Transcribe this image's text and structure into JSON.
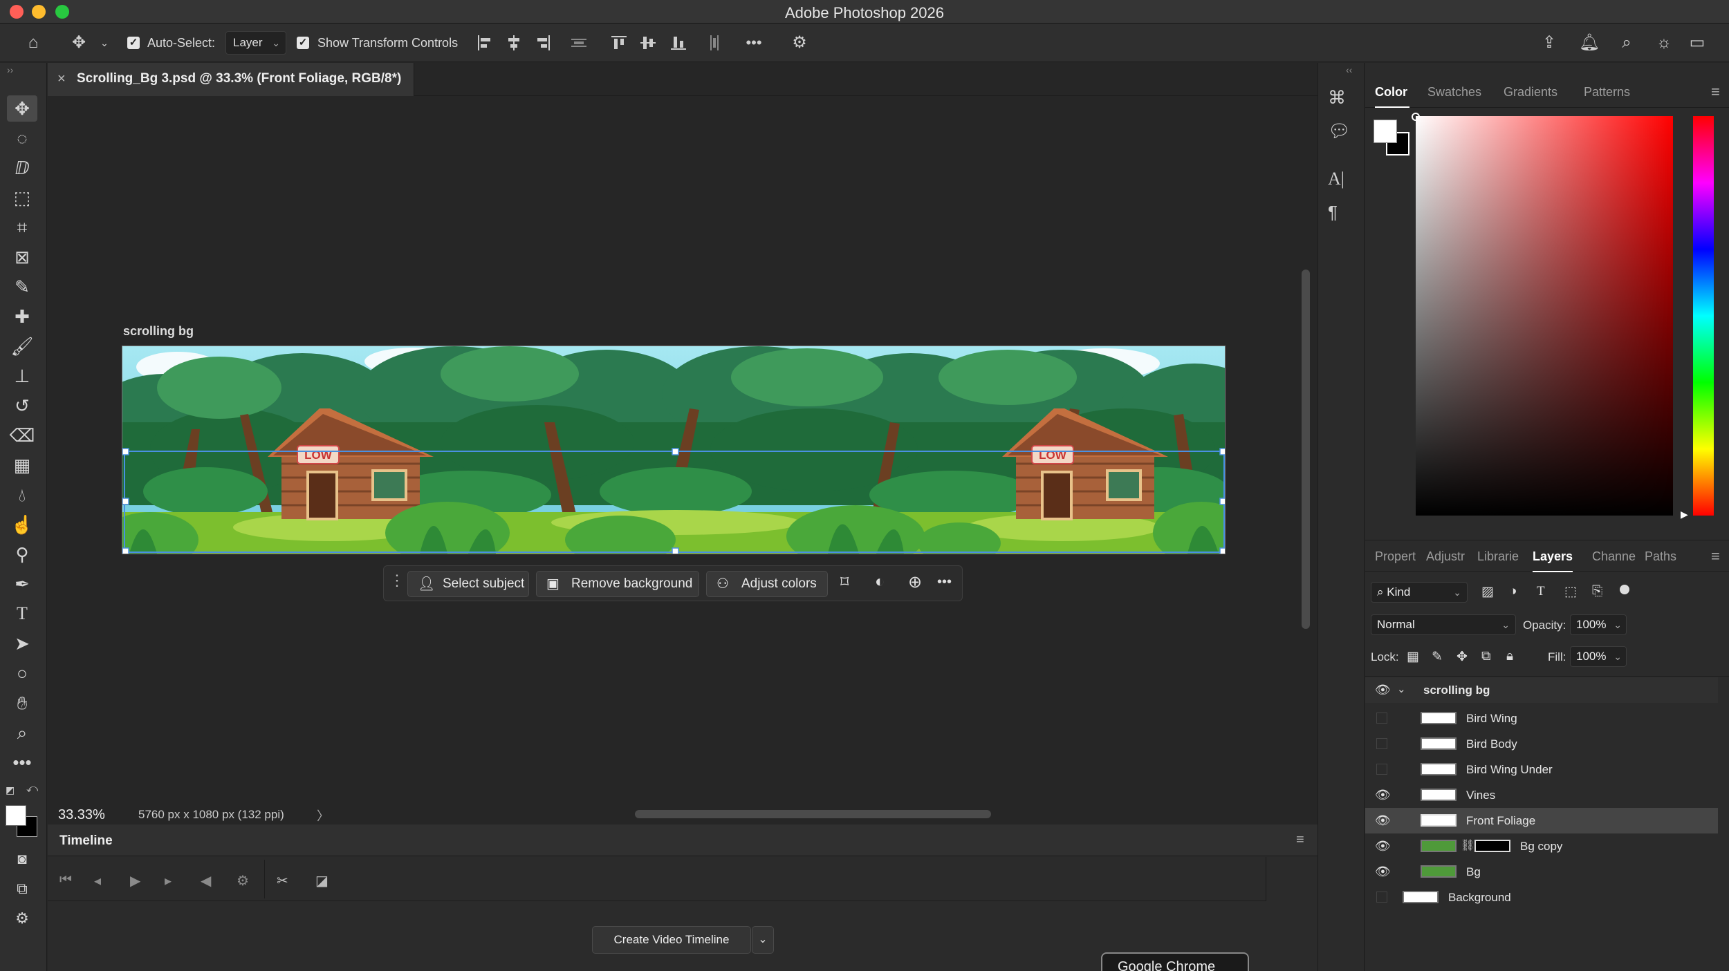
{
  "app": {
    "title": "Adobe Photoshop 2026"
  },
  "options_bar": {
    "auto_select_label": "Auto-Select:",
    "auto_select_value": "Layer",
    "show_transform_label": "Show Transform Controls",
    "more_label": "•••"
  },
  "document": {
    "tab_title": "Scrolling_Bg 3.psd @ 33.3% (Front Foliage, RGB/8*)",
    "artboard_label": "scrolling bg",
    "sign_text": "LOW"
  },
  "taskbar": {
    "select_subject": "Select subject",
    "remove_background": "Remove background",
    "adjust_colors": "Adjust colors",
    "more_label": "•••"
  },
  "status": {
    "zoom": "33.33%",
    "doc_size": "5760 px x 1080 px (132 ppi)",
    "arrow": "〉"
  },
  "timeline": {
    "title": "Timeline",
    "create_button": "Create Video Timeline",
    "tooltip": "Google Chrome"
  },
  "color_panel": {
    "tabs": [
      "Color",
      "Swatches",
      "Gradients",
      "Patterns"
    ],
    "active_tab": "Color"
  },
  "layers_panel": {
    "tabs": [
      "Propert",
      "Adjustr",
      "Librarie",
      "Layers",
      "Channe",
      "Paths"
    ],
    "active_tab": "Layers",
    "filter_kind": "Kind",
    "blend_mode": "Normal",
    "opacity_label": "Opacity:",
    "opacity_value": "100%",
    "lock_label": "Lock:",
    "fill_label": "Fill:",
    "fill_value": "100%",
    "group_name": "scrolling bg",
    "layers": [
      {
        "name": "Bird Wing",
        "visible": false
      },
      {
        "name": "Bird Body",
        "visible": false
      },
      {
        "name": "Bird Wing Under",
        "visible": false
      },
      {
        "name": "Vines",
        "visible": true
      },
      {
        "name": "Front Foliage",
        "visible": true,
        "selected": true
      },
      {
        "name": "Bg copy",
        "visible": true
      },
      {
        "name": "Bg",
        "visible": true
      },
      {
        "name": "Background",
        "visible": false
      }
    ]
  },
  "colors": {
    "accent_selection": "#4a90e2",
    "sky": "#8fdcec",
    "forest_dark": "#1f6b3a",
    "grass": "#7cbf2e"
  }
}
